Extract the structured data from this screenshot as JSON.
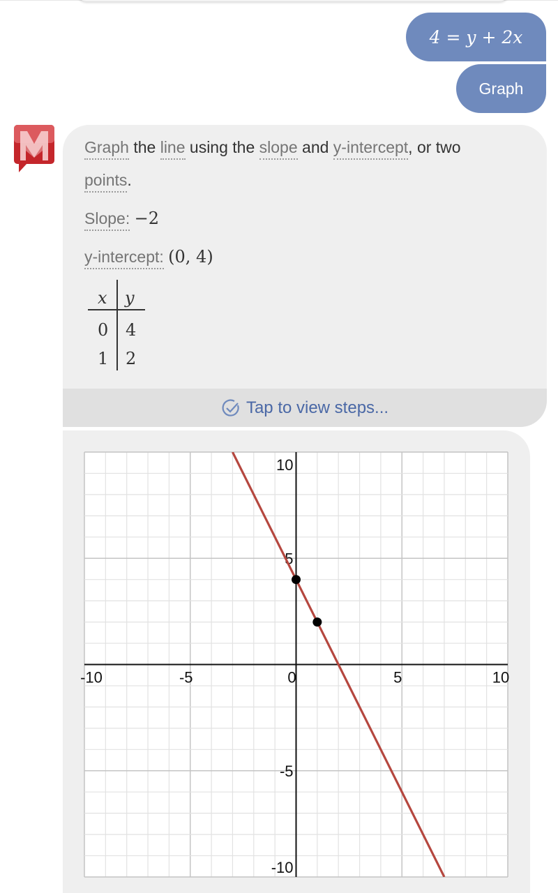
{
  "user_message": {
    "equation": "4 = y + 2x",
    "action_label": "Graph"
  },
  "bot": {
    "logo": "mathway-logo-icon",
    "instruction": {
      "parts": [
        {
          "text": "Graph",
          "term": true
        },
        {
          "text": " the ",
          "term": false
        },
        {
          "text": "line",
          "term": true
        },
        {
          "text": " using the ",
          "term": false
        },
        {
          "text": "slope",
          "term": true
        },
        {
          "text": " and ",
          "term": false
        },
        {
          "text": "y-intercept",
          "term": true
        },
        {
          "text": ", or two",
          "term": false
        }
      ],
      "line2": "points",
      "line2_suffix": "."
    },
    "slope_label": "Slope:",
    "slope_value": "−2",
    "intercept_label": "y-intercept:",
    "intercept_value": "(0, 4)",
    "table": {
      "headers": [
        "x",
        "y"
      ],
      "rows": [
        [
          "0",
          "4"
        ],
        [
          "1",
          "2"
        ]
      ]
    },
    "steps_label": "Tap to view steps...",
    "steps_icon": "check-circle-icon"
  },
  "chart_data": {
    "type": "line",
    "title": "",
    "equation": "y = -2x + 4",
    "series": [
      {
        "name": "4 = y + 2x",
        "slope": -2,
        "intercept": 4,
        "color": "#b5473f"
      }
    ],
    "points": [
      {
        "x": 0,
        "y": 4
      },
      {
        "x": 1,
        "y": 2
      }
    ],
    "xlim": [
      -10,
      10
    ],
    "ylim": [
      -10,
      10
    ],
    "x_ticks": [
      "-10",
      "-5",
      "0",
      "5",
      "10"
    ],
    "y_ticks": [
      "10",
      "5",
      "-5",
      "-10"
    ],
    "x_tick_values": [
      -10,
      -5,
      0,
      5,
      10
    ],
    "y_tick_values": [
      10,
      5,
      -5,
      -10
    ],
    "grid": true,
    "grid_step": 1,
    "major_step": 5,
    "xlabel": "",
    "ylabel": ""
  }
}
